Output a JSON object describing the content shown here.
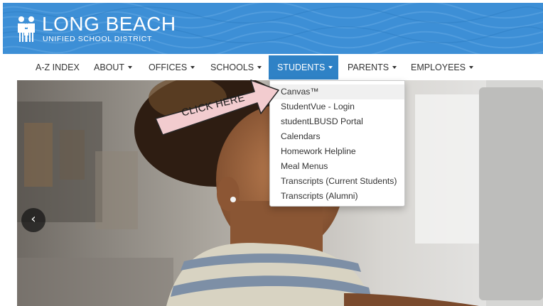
{
  "header": {
    "logo_line1": "LONG BEACH",
    "logo_line2": "UNIFIED SCHOOL DISTRICT",
    "background_color": "#3d8fd6"
  },
  "nav": {
    "items": [
      {
        "label": "A-Z INDEX",
        "has_caret": false,
        "active": false
      },
      {
        "label": "ABOUT",
        "has_caret": true,
        "active": false
      },
      {
        "label": "OFFICES",
        "has_caret": true,
        "active": false
      },
      {
        "label": "SCHOOLS",
        "has_caret": true,
        "active": false
      },
      {
        "label": "STUDENTS",
        "has_caret": true,
        "active": true
      },
      {
        "label": "PARENTS",
        "has_caret": true,
        "active": false
      },
      {
        "label": "EMPLOYEES",
        "has_caret": true,
        "active": false
      }
    ],
    "active_color": "#2f82c6"
  },
  "students_menu": {
    "items": [
      "Canvas™",
      "StudentVue - Login",
      "studentLBUSD Portal",
      "Calendars",
      "Homework Helpline",
      "Meal Menus",
      "Transcripts (Current Students)",
      "Transcripts (Alumni)"
    ],
    "hovered_item": "Canvas™"
  },
  "annotation": {
    "text": "CLICK HERE",
    "arrow_color": "#f2cccf"
  },
  "carousel": {
    "prev_icon": "chevron-left-icon",
    "prev_glyph": "‹"
  }
}
